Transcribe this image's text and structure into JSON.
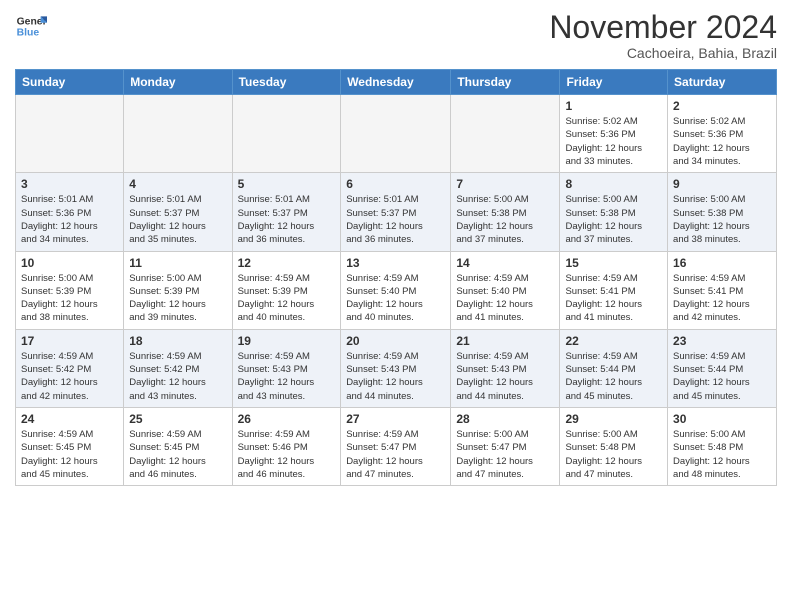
{
  "header": {
    "logo_line1": "General",
    "logo_line2": "Blue",
    "month": "November 2024",
    "location": "Cachoeira, Bahia, Brazil"
  },
  "weekdays": [
    "Sunday",
    "Monday",
    "Tuesday",
    "Wednesday",
    "Thursday",
    "Friday",
    "Saturday"
  ],
  "weeks": [
    [
      {
        "day": "",
        "info": ""
      },
      {
        "day": "",
        "info": ""
      },
      {
        "day": "",
        "info": ""
      },
      {
        "day": "",
        "info": ""
      },
      {
        "day": "",
        "info": ""
      },
      {
        "day": "1",
        "info": "Sunrise: 5:02 AM\nSunset: 5:36 PM\nDaylight: 12 hours\nand 33 minutes."
      },
      {
        "day": "2",
        "info": "Sunrise: 5:02 AM\nSunset: 5:36 PM\nDaylight: 12 hours\nand 34 minutes."
      }
    ],
    [
      {
        "day": "3",
        "info": "Sunrise: 5:01 AM\nSunset: 5:36 PM\nDaylight: 12 hours\nand 34 minutes."
      },
      {
        "day": "4",
        "info": "Sunrise: 5:01 AM\nSunset: 5:37 PM\nDaylight: 12 hours\nand 35 minutes."
      },
      {
        "day": "5",
        "info": "Sunrise: 5:01 AM\nSunset: 5:37 PM\nDaylight: 12 hours\nand 36 minutes."
      },
      {
        "day": "6",
        "info": "Sunrise: 5:01 AM\nSunset: 5:37 PM\nDaylight: 12 hours\nand 36 minutes."
      },
      {
        "day": "7",
        "info": "Sunrise: 5:00 AM\nSunset: 5:38 PM\nDaylight: 12 hours\nand 37 minutes."
      },
      {
        "day": "8",
        "info": "Sunrise: 5:00 AM\nSunset: 5:38 PM\nDaylight: 12 hours\nand 37 minutes."
      },
      {
        "day": "9",
        "info": "Sunrise: 5:00 AM\nSunset: 5:38 PM\nDaylight: 12 hours\nand 38 minutes."
      }
    ],
    [
      {
        "day": "10",
        "info": "Sunrise: 5:00 AM\nSunset: 5:39 PM\nDaylight: 12 hours\nand 38 minutes."
      },
      {
        "day": "11",
        "info": "Sunrise: 5:00 AM\nSunset: 5:39 PM\nDaylight: 12 hours\nand 39 minutes."
      },
      {
        "day": "12",
        "info": "Sunrise: 4:59 AM\nSunset: 5:39 PM\nDaylight: 12 hours\nand 40 minutes."
      },
      {
        "day": "13",
        "info": "Sunrise: 4:59 AM\nSunset: 5:40 PM\nDaylight: 12 hours\nand 40 minutes."
      },
      {
        "day": "14",
        "info": "Sunrise: 4:59 AM\nSunset: 5:40 PM\nDaylight: 12 hours\nand 41 minutes."
      },
      {
        "day": "15",
        "info": "Sunrise: 4:59 AM\nSunset: 5:41 PM\nDaylight: 12 hours\nand 41 minutes."
      },
      {
        "day": "16",
        "info": "Sunrise: 4:59 AM\nSunset: 5:41 PM\nDaylight: 12 hours\nand 42 minutes."
      }
    ],
    [
      {
        "day": "17",
        "info": "Sunrise: 4:59 AM\nSunset: 5:42 PM\nDaylight: 12 hours\nand 42 minutes."
      },
      {
        "day": "18",
        "info": "Sunrise: 4:59 AM\nSunset: 5:42 PM\nDaylight: 12 hours\nand 43 minutes."
      },
      {
        "day": "19",
        "info": "Sunrise: 4:59 AM\nSunset: 5:43 PM\nDaylight: 12 hours\nand 43 minutes."
      },
      {
        "day": "20",
        "info": "Sunrise: 4:59 AM\nSunset: 5:43 PM\nDaylight: 12 hours\nand 44 minutes."
      },
      {
        "day": "21",
        "info": "Sunrise: 4:59 AM\nSunset: 5:43 PM\nDaylight: 12 hours\nand 44 minutes."
      },
      {
        "day": "22",
        "info": "Sunrise: 4:59 AM\nSunset: 5:44 PM\nDaylight: 12 hours\nand 45 minutes."
      },
      {
        "day": "23",
        "info": "Sunrise: 4:59 AM\nSunset: 5:44 PM\nDaylight: 12 hours\nand 45 minutes."
      }
    ],
    [
      {
        "day": "24",
        "info": "Sunrise: 4:59 AM\nSunset: 5:45 PM\nDaylight: 12 hours\nand 45 minutes."
      },
      {
        "day": "25",
        "info": "Sunrise: 4:59 AM\nSunset: 5:45 PM\nDaylight: 12 hours\nand 46 minutes."
      },
      {
        "day": "26",
        "info": "Sunrise: 4:59 AM\nSunset: 5:46 PM\nDaylight: 12 hours\nand 46 minutes."
      },
      {
        "day": "27",
        "info": "Sunrise: 4:59 AM\nSunset: 5:47 PM\nDaylight: 12 hours\nand 47 minutes."
      },
      {
        "day": "28",
        "info": "Sunrise: 5:00 AM\nSunset: 5:47 PM\nDaylight: 12 hours\nand 47 minutes."
      },
      {
        "day": "29",
        "info": "Sunrise: 5:00 AM\nSunset: 5:48 PM\nDaylight: 12 hours\nand 47 minutes."
      },
      {
        "day": "30",
        "info": "Sunrise: 5:00 AM\nSunset: 5:48 PM\nDaylight: 12 hours\nand 48 minutes."
      }
    ]
  ]
}
